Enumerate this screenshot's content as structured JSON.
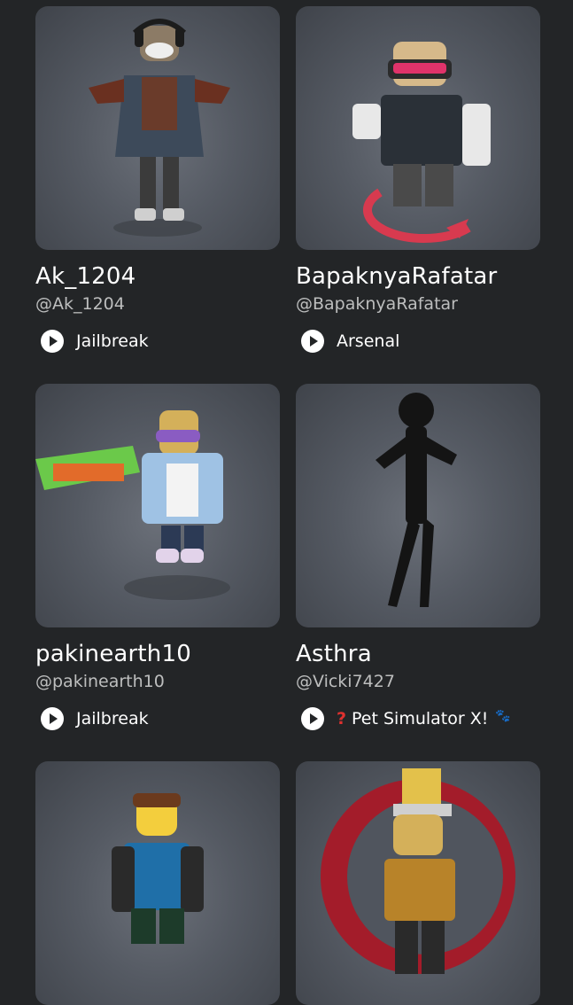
{
  "friends": [
    {
      "display_name": "Ak_1204",
      "username": "@Ak_1204",
      "game": "Jailbreak"
    },
    {
      "display_name": "BapaknyaRafatar",
      "username": "@BapaknyaRafatar",
      "game": "Arsenal"
    },
    {
      "display_name": "pakinearth10",
      "username": "@pakinearth10",
      "game": "Jailbreak"
    },
    {
      "display_name": "Asthra",
      "username": "@Vicki7427",
      "game": "Pet Simulator X!",
      "game_prefix": "?",
      "game_suffix": "🐾"
    },
    {
      "display_name": "",
      "username": "",
      "game": ""
    },
    {
      "display_name": "",
      "username": "",
      "game": ""
    }
  ],
  "colors": {
    "background": "#232527",
    "card": "#555a63",
    "handle": "#bdbebe"
  }
}
